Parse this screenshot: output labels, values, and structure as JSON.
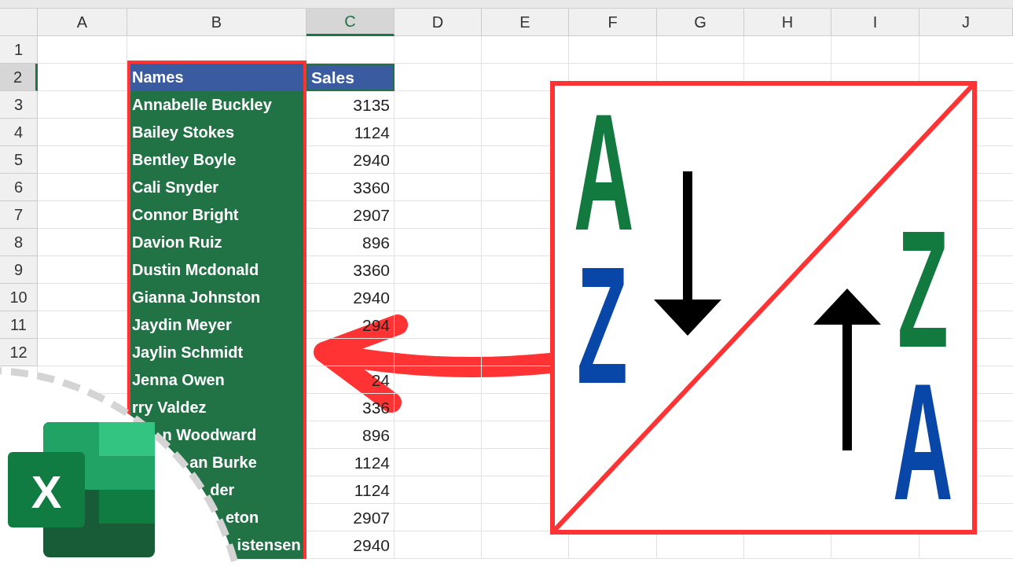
{
  "columns": [
    {
      "label": "A",
      "selected": false
    },
    {
      "label": "B",
      "selected": false
    },
    {
      "label": "C",
      "selected": true
    },
    {
      "label": "D",
      "selected": false
    },
    {
      "label": "E",
      "selected": false
    },
    {
      "label": "F",
      "selected": false
    },
    {
      "label": "G",
      "selected": false
    },
    {
      "label": "H",
      "selected": false
    },
    {
      "label": "I",
      "selected": false
    },
    {
      "label": "J",
      "selected": false
    }
  ],
  "rows": [
    {
      "kind": "blank",
      "number": "1",
      "selected": false
    },
    {
      "kind": "header",
      "number": "2",
      "selected": true,
      "name": "Names",
      "sales": "Sales"
    },
    {
      "kind": "data",
      "number": "3",
      "selected": false,
      "name": "Annabelle Buckley",
      "sales": "3135"
    },
    {
      "kind": "data",
      "number": "4",
      "selected": false,
      "name": "Bailey Stokes",
      "sales": "1124"
    },
    {
      "kind": "data",
      "number": "5",
      "selected": false,
      "name": "Bentley Boyle",
      "sales": "2940"
    },
    {
      "kind": "data",
      "number": "6",
      "selected": false,
      "name": "Cali Snyder",
      "sales": "3360"
    },
    {
      "kind": "data",
      "number": "7",
      "selected": false,
      "name": "Connor Bright",
      "sales": "2907"
    },
    {
      "kind": "data",
      "number": "8",
      "selected": false,
      "name": "Davion Ruiz",
      "sales": "896"
    },
    {
      "kind": "data",
      "number": "9",
      "selected": false,
      "name": "Dustin Mcdonald",
      "sales": "3360"
    },
    {
      "kind": "data",
      "number": "10",
      "selected": false,
      "name": "Gianna Johnston",
      "sales": "2940"
    },
    {
      "kind": "data",
      "number": "11",
      "selected": false,
      "name": "Jaydin Meyer",
      "sales": "294"
    },
    {
      "kind": "data",
      "number": "12",
      "selected": false,
      "name": "Jaylin Schmidt"
    },
    {
      "kind": "data",
      "name": "Jenna Owen",
      "sales": "24"
    },
    {
      "kind": "data",
      "name": "rry Valdez",
      "sales": "336"
    },
    {
      "kind": "data",
      "name": "n Woodward",
      "sales": "896"
    },
    {
      "kind": "data",
      "name": "an Burke",
      "sales": "1124"
    },
    {
      "kind": "data",
      "name": "der",
      "sales": "1124"
    },
    {
      "kind": "data",
      "name": "eton",
      "sales": "2907"
    },
    {
      "kind": "data",
      "name": "istensen",
      "sales": "2940"
    }
  ],
  "sort_graphic": {
    "ascending": {
      "top": "A",
      "bottom": "Z"
    },
    "descending": {
      "top": "Z",
      "bottom": "A"
    }
  },
  "logo": {
    "letter": "X"
  }
}
